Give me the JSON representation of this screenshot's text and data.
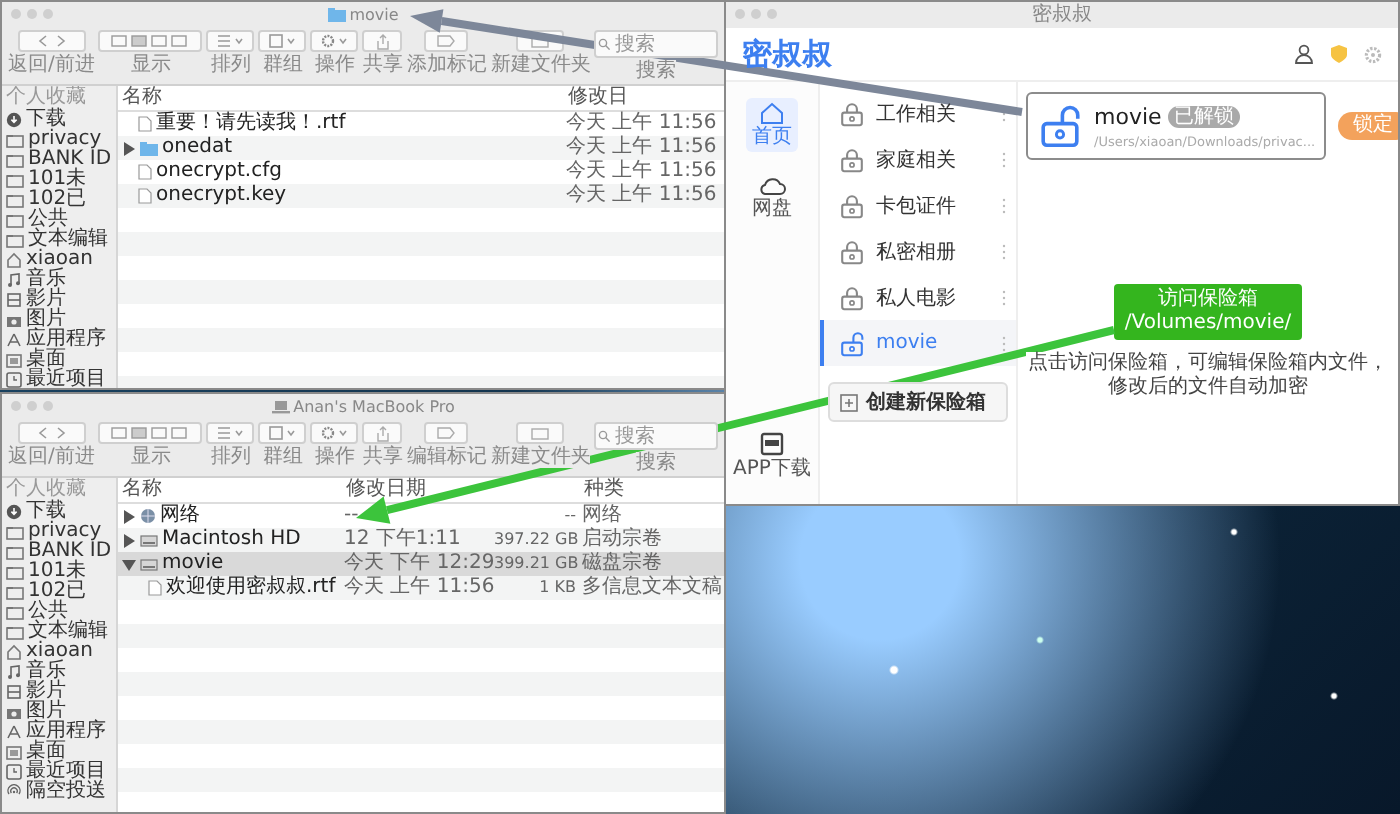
{
  "finder_windows": [
    {
      "title": "movie",
      "toolbar": [
        {
          "kind": "nav",
          "label": "返回/前进"
        },
        {
          "kind": "view",
          "label": "显示"
        },
        {
          "kind": "arrange",
          "label": "排列"
        },
        {
          "kind": "group",
          "label": "群组"
        },
        {
          "kind": "action",
          "label": "操作"
        },
        {
          "kind": "share",
          "label": "共享"
        },
        {
          "kind": "tag",
          "label": "添加标记"
        },
        {
          "kind": "newfolder",
          "label": "新建文件夹"
        },
        {
          "kind": "search",
          "label": "搜索",
          "placeholder": "搜索"
        }
      ],
      "sidebar": {
        "heading": "个人收藏",
        "items": [
          {
            "kind": "download",
            "label": "下载"
          },
          {
            "kind": "folder",
            "label": "privacy"
          },
          {
            "kind": "folder",
            "label": "BANK ID"
          },
          {
            "kind": "folder",
            "label": "101未"
          },
          {
            "kind": "folder",
            "label": "102已"
          },
          {
            "kind": "folder",
            "label": "公共"
          },
          {
            "kind": "folder",
            "label": "文本编辑"
          },
          {
            "kind": "home",
            "label": "xiaoan"
          },
          {
            "kind": "music",
            "label": "音乐"
          },
          {
            "kind": "movie",
            "label": "影片"
          },
          {
            "kind": "picture",
            "label": "图片"
          },
          {
            "kind": "apps",
            "label": "应用程序"
          },
          {
            "kind": "desktop",
            "label": "桌面"
          },
          {
            "kind": "recent",
            "label": "最近项目"
          }
        ]
      },
      "columns": {
        "name": "名称",
        "date": "修改日"
      },
      "rows": [
        {
          "kind": "file",
          "name": "重要！请先读我！.rtf",
          "date": "今天 上午 11:56",
          "expandable": false,
          "selected": false
        },
        {
          "kind": "folder",
          "name": "onedat",
          "date": "今天 上午 11:56",
          "expandable": true,
          "expanded": false,
          "selected": false
        },
        {
          "kind": "file",
          "name": "onecrypt.cfg",
          "date": "今天 上午 11:56",
          "expandable": false,
          "selected": false
        },
        {
          "kind": "file",
          "name": "onecrypt.key",
          "date": "今天 上午 11:56",
          "expandable": false,
          "selected": false
        }
      ]
    },
    {
      "title": "Anan's MacBook Pro",
      "toolbar": [
        {
          "kind": "nav",
          "label": "返回/前进"
        },
        {
          "kind": "view",
          "label": "显示"
        },
        {
          "kind": "arrange",
          "label": "排列"
        },
        {
          "kind": "group",
          "label": "群组"
        },
        {
          "kind": "action",
          "label": "操作"
        },
        {
          "kind": "share",
          "label": "共享"
        },
        {
          "kind": "tag",
          "label": "编辑标记"
        },
        {
          "kind": "newfolder",
          "label": "新建文件夹"
        },
        {
          "kind": "search",
          "label": "搜索",
          "placeholder": "搜索"
        }
      ],
      "sidebar": {
        "heading": "个人收藏",
        "items": [
          {
            "kind": "download",
            "label": "下载"
          },
          {
            "kind": "folder",
            "label": "privacy"
          },
          {
            "kind": "folder",
            "label": "BANK ID"
          },
          {
            "kind": "folder",
            "label": "101未"
          },
          {
            "kind": "folder",
            "label": "102已"
          },
          {
            "kind": "folder",
            "label": "公共"
          },
          {
            "kind": "folder",
            "label": "文本编辑"
          },
          {
            "kind": "home",
            "label": "xiaoan"
          },
          {
            "kind": "music",
            "label": "音乐"
          },
          {
            "kind": "movie",
            "label": "影片"
          },
          {
            "kind": "picture",
            "label": "图片"
          },
          {
            "kind": "apps",
            "label": "应用程序"
          },
          {
            "kind": "desktop",
            "label": "桌面"
          },
          {
            "kind": "recent",
            "label": "最近项目"
          },
          {
            "kind": "airdrop",
            "label": "隔空投送"
          }
        ]
      },
      "columns": {
        "name": "名称",
        "date": "修改日期",
        "kind": "种类"
      },
      "rows": [
        {
          "kind": "network",
          "name": "网络",
          "date": "--",
          "size": "--",
          "type": "网络",
          "expandable": true,
          "expanded": false,
          "selected": false
        },
        {
          "kind": "disk",
          "name": "Macintosh HD",
          "date": "12 下午1:11",
          "size": "397.22 GB",
          "type": "启动宗卷",
          "expandable": true,
          "expanded": false,
          "selected": false
        },
        {
          "kind": "disk",
          "name": "movie",
          "date": "今天 下午 12:29",
          "size": "399.21 GB",
          "type": "磁盘宗卷",
          "expandable": true,
          "expanded": true,
          "selected": true,
          "children": [
            {
              "kind": "file",
              "name": "欢迎使用密叔叔.rtf",
              "date": "今天 上午 11:56",
              "size": "1 KB",
              "type": "多信息文本文稿",
              "expandable": false,
              "selected": false
            }
          ]
        }
      ]
    }
  ],
  "app": {
    "title": "密叔叔",
    "logo": "密叔叔",
    "nav": [
      {
        "kind": "home",
        "label": "首页",
        "selected": true
      },
      {
        "kind": "cloud",
        "label": "网盘",
        "selected": false
      },
      {
        "kind": "app",
        "label": "APP下载",
        "selected": false
      }
    ],
    "vaults": [
      {
        "name": "工作相关",
        "unlocked": false,
        "selected": false
      },
      {
        "name": "家庭相关",
        "unlocked": false,
        "selected": false
      },
      {
        "name": "卡包证件",
        "unlocked": false,
        "selected": false
      },
      {
        "name": "私密相册",
        "unlocked": false,
        "selected": false
      },
      {
        "name": "私人电影",
        "unlocked": false,
        "selected": false
      },
      {
        "name": "movie",
        "unlocked": true,
        "selected": true
      }
    ],
    "create_button": "创建新保险箱",
    "detail": {
      "name": "movie",
      "badge": "已解锁",
      "path": "/Users/xiaoan/Downloads/privac...",
      "unlocked": true,
      "button": "锁定"
    },
    "tooltip": {
      "title": "访问保险箱",
      "path": "/Volumes/movie/"
    },
    "hint": "点击访问保险箱，可编辑保险箱内文件，修改后的文件自动加密"
  }
}
